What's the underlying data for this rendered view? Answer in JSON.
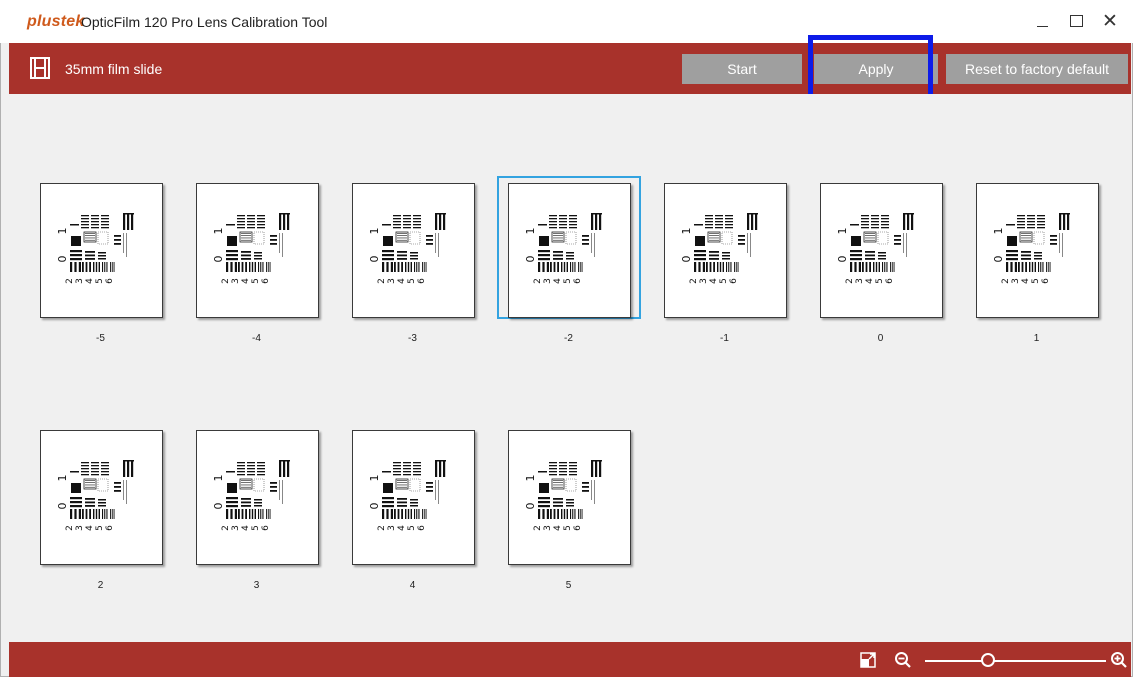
{
  "window": {
    "brand": "plustek",
    "title": "OpticFilm 120 Pro Lens Calibration Tool",
    "controls": [
      "minimize-icon",
      "maximize-icon",
      "close-icon"
    ]
  },
  "toolbar": {
    "mode_icon": "film-strip-icon",
    "mode_label": "35mm film slide",
    "start_label": "Start",
    "apply_label": "Apply",
    "reset_label": "Reset to factory default",
    "button_color": "#9f9f9f",
    "bar_color": "#a8322b"
  },
  "thumbnails": [
    {
      "label": "-5"
    },
    {
      "label": "-4"
    },
    {
      "label": "-3"
    },
    {
      "label": "-2",
      "selected": true
    },
    {
      "label": "-1"
    },
    {
      "label": "0"
    },
    {
      "label": "1"
    },
    {
      "label": "2"
    },
    {
      "label": "3"
    },
    {
      "label": "4"
    },
    {
      "label": "5"
    }
  ],
  "chart_text": {
    "top_num": "1",
    "mid_num": "0",
    "bottom_nums": "2 3 4 5 6"
  },
  "footer": {
    "icons": [
      "fit-to-window-icon",
      "zoom-out-icon",
      "zoom-in-icon"
    ],
    "zoom_level": 0.35
  },
  "colors": {
    "selection": "#33a3e0",
    "highlight": "#0d1be8",
    "brand": "#cf5a1c"
  }
}
